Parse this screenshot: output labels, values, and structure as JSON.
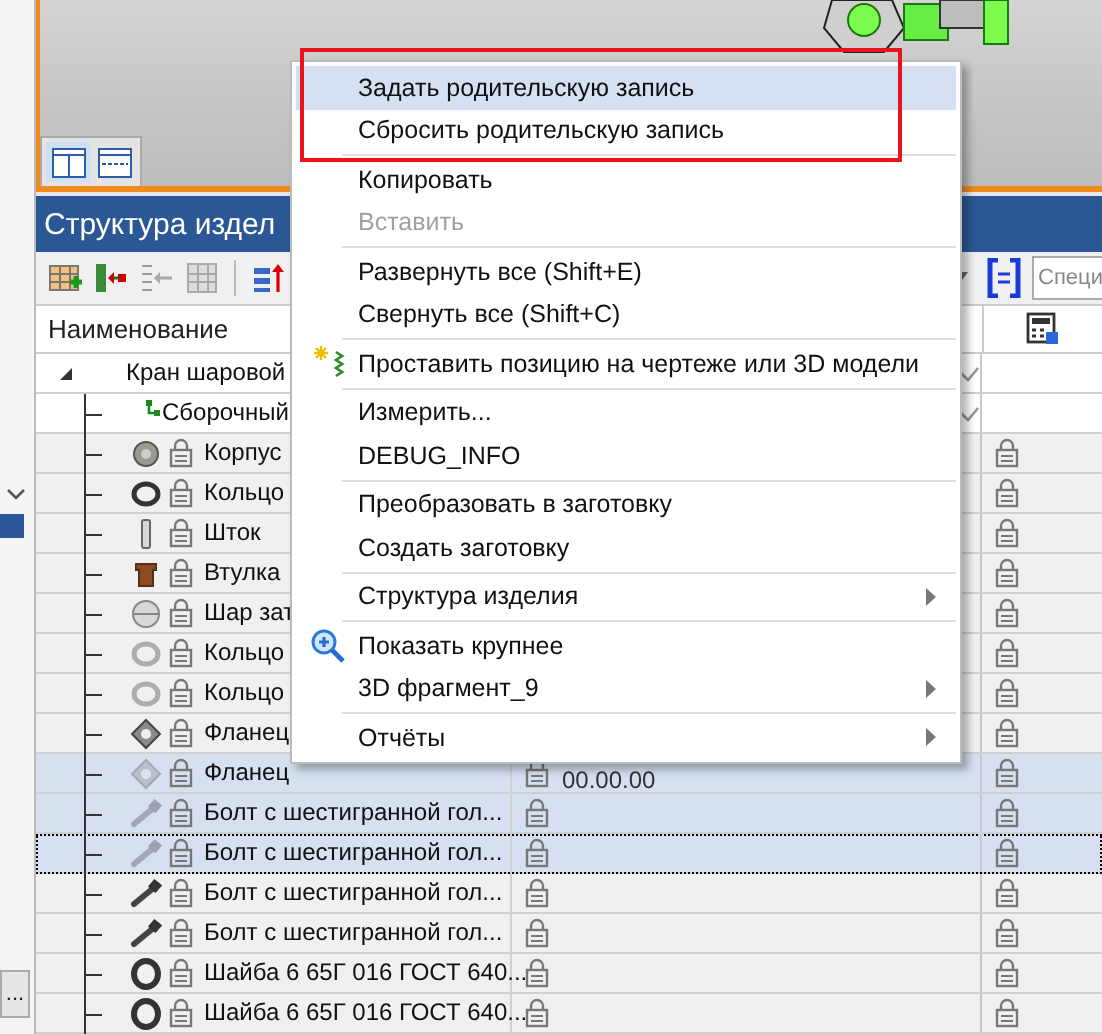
{
  "viewport": {
    "view_buttons": [
      {
        "selected": true
      },
      {
        "selected": false
      }
    ]
  },
  "panel": {
    "title": "Структура издел"
  },
  "toolbar": {
    "search": {
      "placeholder": "Специ"
    }
  },
  "table": {
    "columns": [
      {
        "label": "Наименование"
      }
    ],
    "rows": [
      {
        "kind": "assembly",
        "name": "Кран шаровой",
        "expanded": true,
        "selected": false,
        "focused": false
      },
      {
        "kind": "subassembly",
        "name": "Сборочный",
        "selected": false,
        "focused": false
      },
      {
        "kind": "housing",
        "name": "Корпус",
        "selected": false,
        "focused": false,
        "faded": false
      },
      {
        "kind": "ring",
        "name": "Кольцо",
        "selected": false,
        "focused": false,
        "faded": false
      },
      {
        "kind": "rod",
        "name": "Шток",
        "selected": false,
        "focused": false,
        "faded": false
      },
      {
        "kind": "bushing",
        "name": "Втулка",
        "selected": false,
        "focused": false,
        "faded": false
      },
      {
        "kind": "ball",
        "name": "Шар зат",
        "selected": false,
        "focused": false,
        "faded": false
      },
      {
        "kind": "ring",
        "name": "Кольцо",
        "selected": false,
        "focused": false,
        "faded": true
      },
      {
        "kind": "ring",
        "name": "Кольцо",
        "selected": false,
        "focused": false,
        "faded": true
      },
      {
        "kind": "flange",
        "name": "Фланец",
        "selected": false,
        "focused": false,
        "faded": false
      },
      {
        "kind": "flange",
        "name": "Фланец",
        "selected": true,
        "focused": false,
        "faded": true,
        "column_2": "00.00.00"
      },
      {
        "kind": "bolt",
        "name": "Болт с шестигранной гол...",
        "selected": true,
        "focused": false,
        "faded": true
      },
      {
        "kind": "bolt",
        "name": "Болт с шестигранной гол...",
        "selected": true,
        "focused": true,
        "faded": true
      },
      {
        "kind": "bolt",
        "name": "Болт с шестигранной гол...",
        "selected": false,
        "focused": false,
        "faded": false
      },
      {
        "kind": "bolt",
        "name": "Болт с шестигранной гол...",
        "selected": false,
        "focused": false,
        "faded": false
      },
      {
        "kind": "washer",
        "name": "Шайба 6 65Г 016 ГОСТ 640...",
        "selected": false,
        "focused": false,
        "faded": false
      },
      {
        "kind": "washer",
        "name": "Шайба 6 65Г 016 ГОСТ 640...",
        "selected": false,
        "focused": false,
        "faded": false
      }
    ]
  },
  "context_menu": {
    "items": [
      {
        "kind": "plain",
        "label": "Задать родительскую запись",
        "highlighted": true,
        "disabled": false
      },
      {
        "kind": "plain",
        "label": "Сбросить родительскую запись",
        "highlighted": false,
        "disabled": false
      },
      {
        "kind": "separator"
      },
      {
        "kind": "plain",
        "label": "Копировать",
        "highlighted": false,
        "disabled": false
      },
      {
        "kind": "plain",
        "label": "Вставить",
        "highlighted": false,
        "disabled": true
      },
      {
        "kind": "separator"
      },
      {
        "kind": "plain",
        "label": "Развернуть все (Shift+E)",
        "highlighted": false,
        "disabled": false
      },
      {
        "kind": "plain",
        "label": "Свернуть все (Shift+C)",
        "highlighted": false,
        "disabled": false
      },
      {
        "kind": "separator"
      },
      {
        "kind": "marker",
        "label": "Проставить позицию на чертеже или 3D модели",
        "highlighted": false,
        "disabled": false
      },
      {
        "kind": "separator"
      },
      {
        "kind": "plain",
        "label": "Измерить...",
        "highlighted": false,
        "disabled": false
      },
      {
        "kind": "plain",
        "label": "DEBUG_INFO",
        "highlighted": false,
        "disabled": false
      },
      {
        "kind": "separator"
      },
      {
        "kind": "plain",
        "label": "Преобразовать в заготовку",
        "highlighted": false,
        "disabled": false
      },
      {
        "kind": "plain",
        "label": "Создать заготовку",
        "highlighted": false,
        "disabled": false
      },
      {
        "kind": "separator"
      },
      {
        "kind": "plain",
        "label": "Структура изделия",
        "submenu": true,
        "highlighted": false,
        "disabled": false
      },
      {
        "kind": "separator"
      },
      {
        "kind": "magnifier",
        "label": "Показать крупнее",
        "highlighted": false,
        "disabled": false
      },
      {
        "kind": "plain",
        "label": "3D фрагмент_9",
        "submenu": true,
        "highlighted": false,
        "disabled": false
      },
      {
        "kind": "separator"
      },
      {
        "kind": "plain",
        "label": "Отчёты",
        "submenu": true,
        "highlighted": false,
        "disabled": false
      }
    ]
  },
  "side_panel": {
    "button": "..."
  }
}
